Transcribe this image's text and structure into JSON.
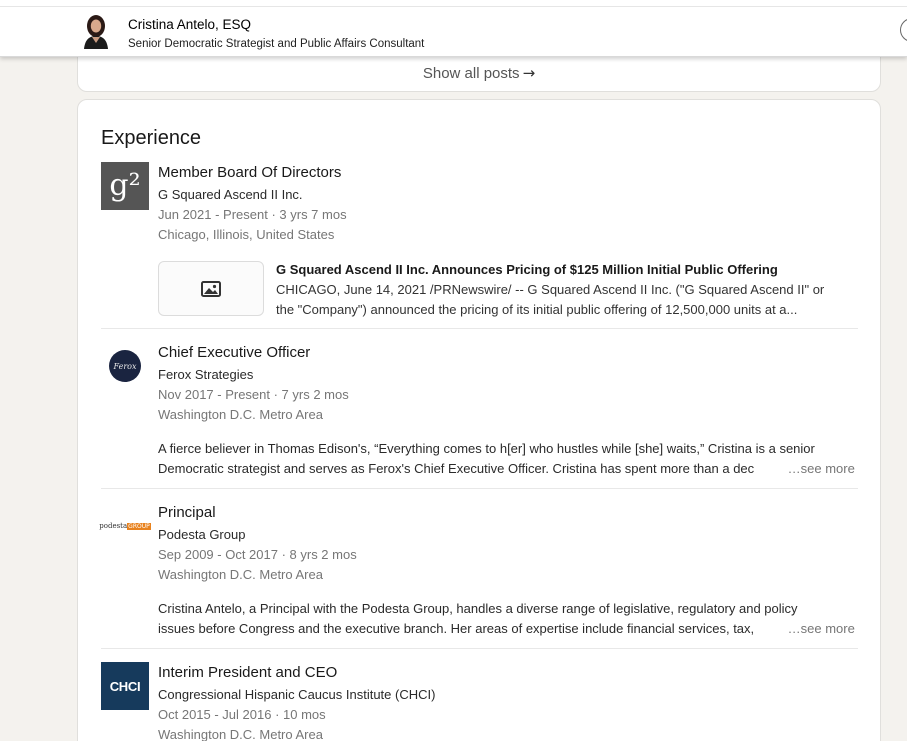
{
  "sticky_header": {
    "top_fragment": "",
    "name": "Cristina Antelo, ESQ",
    "headline": "Senior Democratic Strategist and Public Affairs Consultant"
  },
  "posts": {
    "show_all_label": "Show all posts",
    "arrow": "→"
  },
  "experience": {
    "title": "Experience",
    "items": [
      {
        "title": "Member Board Of Directors",
        "org": "G Squared Ascend II Inc.",
        "dates": "Jun 2021 - Present · 3 yrs 7 mos",
        "location": "Chicago, Illinois, United States",
        "logo": "g²",
        "media": {
          "title": "G Squared Ascend II Inc. Announces Pricing of $125 Million Initial Public Offering",
          "desc_line1": "CHICAGO, June 14, 2021 /PRNewswire/ -- G Squared Ascend II Inc. (\"G Squared Ascend II\" or",
          "desc_line2": "the \"Company\") announced the pricing of its initial public offering of 12,500,000 units at a..."
        }
      },
      {
        "title": "Chief Executive Officer",
        "org": "Ferox Strategies",
        "dates": "Nov 2017 - Present · 7 yrs 2 mos",
        "location": "Washington D.C. Metro Area",
        "logo": "Ferox",
        "desc_line1": "A fierce believer in Thomas Edison's, “Everything comes to h[er] who hustles while [she] waits,” Cristina is a senior",
        "desc_line2": "Democratic strategist and serves as Ferox's Chief Executive Officer. Cristina has spent more than a dec",
        "see_more": "…see more"
      },
      {
        "title": "Principal",
        "org": "Podesta Group",
        "dates": "Sep 2009 - Oct 2017 · 8 yrs 2 mos",
        "location": "Washington D.C. Metro Area",
        "logo_word1": "podesta",
        "logo_word2": "GROUP",
        "desc_line1": "Cristina Antelo, a Principal with the Podesta Group, handles a diverse range of legislative, regulatory and policy",
        "desc_line2": "issues before Congress and the executive branch. Her areas of expertise include financial services, tax,",
        "see_more": "…see more"
      },
      {
        "title": "Interim President and CEO",
        "org": "Congressional Hispanic Caucus Institute (CHCI)",
        "dates": "Oct 2015 - Jul 2016 · 10 mos",
        "location": "Washington D.C. Metro Area",
        "logo": "CHCI"
      }
    ]
  },
  "colors": {
    "page_bg": "#f4f2ee",
    "card_bg": "#ffffff",
    "muted_text": "#767676",
    "chci_logo_bg": "#163a5c",
    "ferox_logo_bg": "#1a2440",
    "g2_logo_bg": "#555555",
    "podesta_orange": "#e8821e"
  }
}
